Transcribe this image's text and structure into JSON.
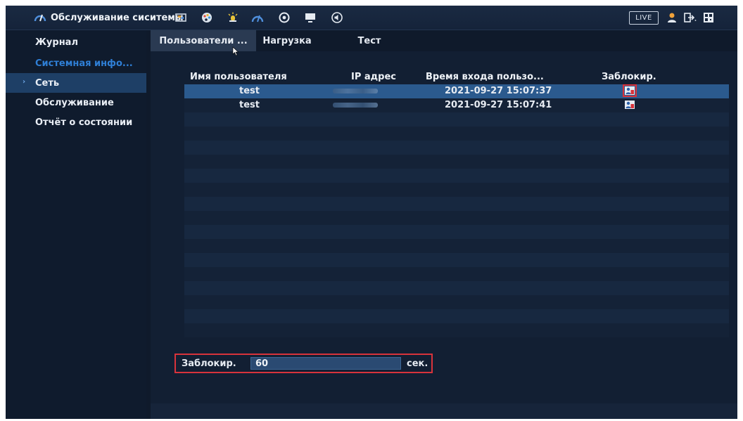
{
  "header": {
    "title": "Обслуживание сиситемы",
    "icons": [
      "gauge-icon",
      "display-icon",
      "palette-icon",
      "alarm-icon",
      "gauge-icon",
      "disc-icon",
      "monitor-icon",
      "speaker-icon",
      "user-icon",
      "logout-icon",
      "qr-icon"
    ],
    "live_label": "LIVE"
  },
  "sidebar": {
    "items": [
      {
        "label": "Журнал"
      },
      {
        "label": "Системная инфо..."
      },
      {
        "label": "Сеть"
      },
      {
        "label": "Обслуживание"
      },
      {
        "label": "Отчёт о состоянии"
      }
    ]
  },
  "tabs": [
    {
      "label": "Пользователи ..."
    },
    {
      "label": "Нагрузка"
    },
    {
      "label": "Тест"
    }
  ],
  "table": {
    "headers": [
      "Имя пользователя",
      "IP адрес",
      "Время входа пользо...",
      "Заблокир."
    ],
    "rows": [
      {
        "user": "test",
        "time": "2021-09-27 15:07:37",
        "selected": true
      },
      {
        "user": "test",
        "time": "2021-09-27 15:07:41",
        "selected": false
      }
    ]
  },
  "lock": {
    "label": "Заблокир.",
    "value": "60",
    "unit": "сек."
  },
  "colors": {
    "background": "#0f1a2b",
    "accent": "#2f7fd6",
    "selected_row": "#2b5a8e",
    "highlight_box": "#d8333b"
  }
}
